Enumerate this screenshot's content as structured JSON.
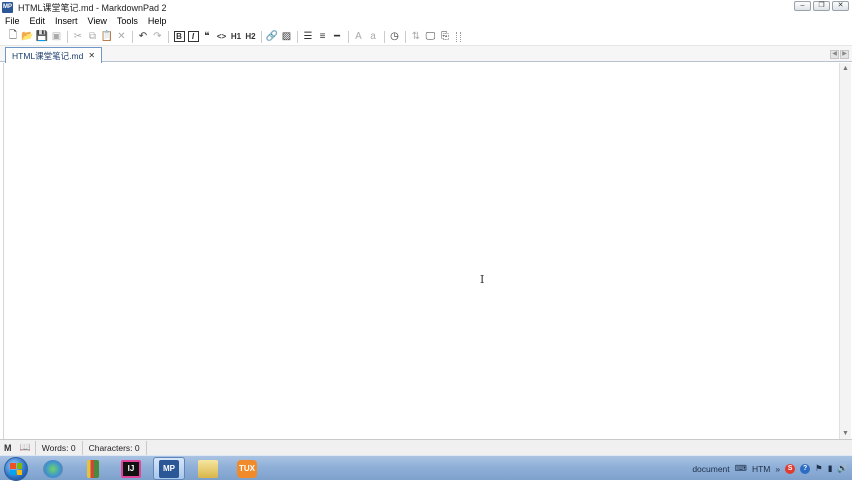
{
  "window": {
    "title": "HTML课堂笔记.md - MarkdownPad 2",
    "logo_text": "MP",
    "controls": [
      "minimize",
      "restore",
      "close"
    ]
  },
  "menu": [
    "File",
    "Edit",
    "Insert",
    "View",
    "Tools",
    "Help"
  ],
  "toolbar": {
    "bold_label": "B",
    "italic_label": "I",
    "h1_label": "H1",
    "h2_label": "H2",
    "font_upper_label": "A",
    "font_lower_label": "a"
  },
  "tabs": [
    {
      "label": "HTML课堂笔记.md",
      "active": true
    }
  ],
  "status": {
    "words": "Words: 0",
    "characters": "Characters: 0"
  },
  "taskbar": {
    "apps": [
      "sphere-icon",
      "pencils-icon",
      "intellij-icon",
      "markdownpad-icon",
      "folder-icon",
      "tux-icon"
    ],
    "active_app": "markdownpad-icon",
    "tray_text_document": "document",
    "tray_text_htm": "HTM"
  },
  "colors": {
    "taskbar": "#8fb0d8",
    "tab_border": "#6f97c8",
    "markdownpad_blue": "#2b5797"
  }
}
